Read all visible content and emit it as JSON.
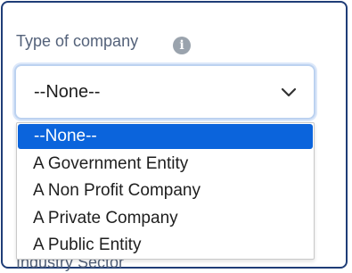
{
  "field": {
    "label": "Type of company",
    "info_icon": "info-icon",
    "selected_value": "--None--",
    "chevron_icon": "chevron-down-icon"
  },
  "dropdown": {
    "options": [
      {
        "label": "--None--",
        "selected": true
      },
      {
        "label": "A Government Entity",
        "selected": false
      },
      {
        "label": "A Non Profit Company",
        "selected": false
      },
      {
        "label": "A Private Company",
        "selected": false
      },
      {
        "label": "A Public Entity",
        "selected": false
      }
    ],
    "highlight_color": "#0b64dc"
  },
  "next_field": {
    "label": "Industry Sector"
  },
  "colors": {
    "frame_border": "#1f3d77",
    "select_border": "#bcd2f0"
  }
}
